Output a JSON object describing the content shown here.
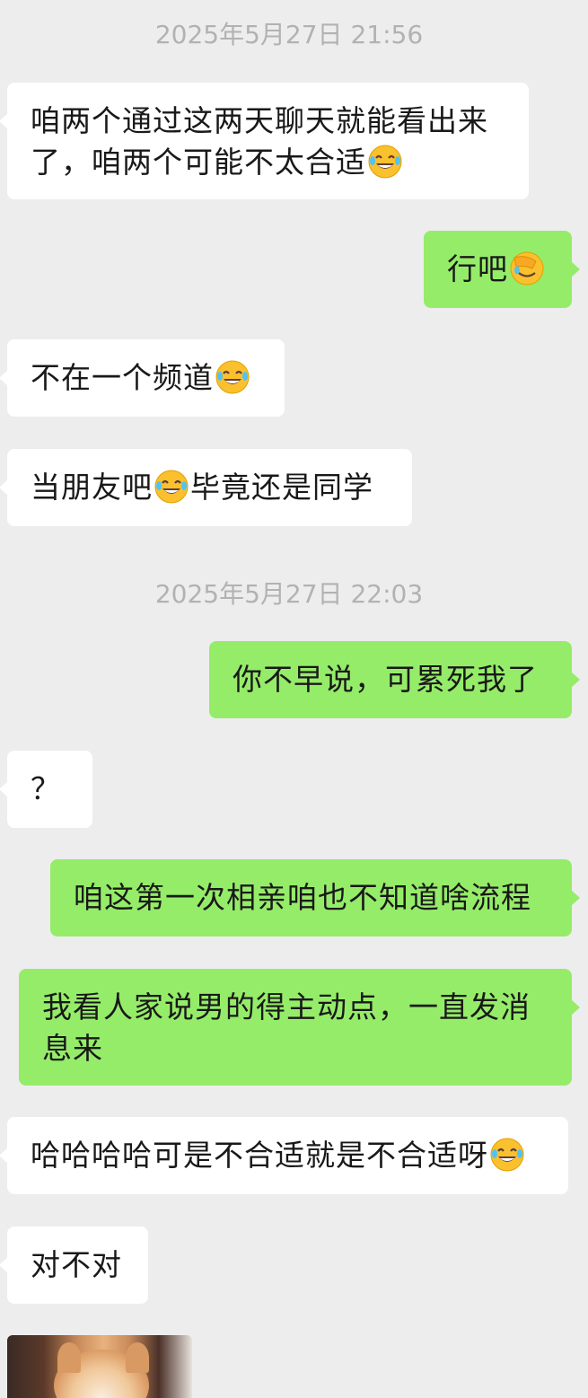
{
  "colors": {
    "background": "#ededed",
    "incoming_bubble": "#ffffff",
    "outgoing_bubble": "#95ec69",
    "timestamp_text": "#b2b2b2",
    "message_text": "#191919"
  },
  "timestamps": [
    "2025年5月27日 21:56",
    "2025年5月27日 22:03"
  ],
  "messages": [
    {
      "from": "other",
      "line1": "咱两个通过这两天聊天就能看出来",
      "line2": "了，咱两个可能不太合适",
      "emoji": "tears-of-joy"
    },
    {
      "from": "me",
      "text": "行吧",
      "emoji": "face-palm"
    },
    {
      "from": "other",
      "text": "不在一个频道",
      "emoji": "tears-of-joy"
    },
    {
      "from": "other",
      "text_before": "当朋友吧",
      "emoji": "tears-of-joy",
      "text_after": "毕竟还是同学"
    },
    {
      "from": "me",
      "text": "你不早说，可累死我了"
    },
    {
      "from": "other",
      "text": "？"
    },
    {
      "from": "me",
      "text": "咱这第一次相亲咱也不知道啥流程"
    },
    {
      "from": "me",
      "line1": "我看人家说男的得主动点，一直发消",
      "line2": "息来"
    },
    {
      "from": "other",
      "text": "哈哈哈哈可是不合适就是不合适呀",
      "emoji": "tears-of-joy"
    },
    {
      "from": "other",
      "text": "对不对"
    },
    {
      "from": "other",
      "image": "shiba-dog-photo"
    }
  ]
}
